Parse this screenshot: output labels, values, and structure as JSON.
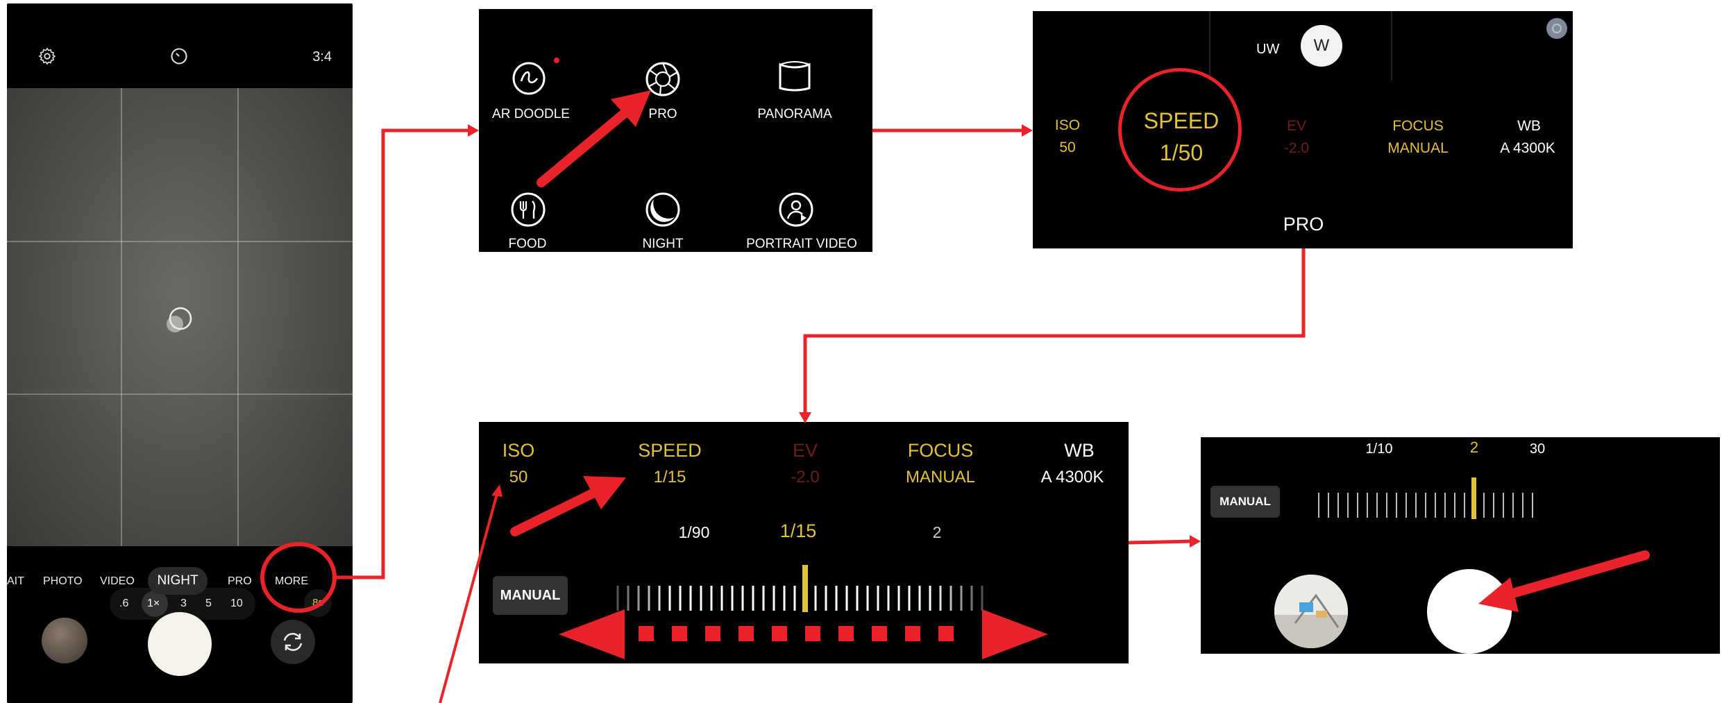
{
  "phone": {
    "aspect": "3:4",
    "icons": {
      "settings": "gear-icon",
      "timer": "timer-icon"
    },
    "zoom_levels": [
      ".6",
      "1×",
      "3",
      "5",
      "10"
    ],
    "timer_badge": "8s",
    "modes": [
      "AIT",
      "PHOTO",
      "VIDEO",
      "NIGHT",
      "PRO",
      "MORE"
    ]
  },
  "more_modes": {
    "items": [
      {
        "label": "AR DOODLE",
        "icon": "ar-doodle-icon"
      },
      {
        "label": "PRO",
        "icon": "aperture-icon"
      },
      {
        "label": "PANORAMA",
        "icon": "panorama-icon"
      },
      {
        "label": "FOOD",
        "icon": "food-icon"
      },
      {
        "label": "NIGHT",
        "icon": "moon-icon"
      },
      {
        "label": "PORTRAIT VIDEO",
        "icon": "portrait-video-icon"
      }
    ]
  },
  "pro_mode": {
    "lens": {
      "ultrawide": "UW",
      "wide": "W"
    },
    "settings": [
      {
        "label": "ISO",
        "value": "50"
      },
      {
        "label": "SPEED",
        "value": "1/50"
      },
      {
        "label": "EV",
        "value": "-2.0"
      },
      {
        "label": "FOCUS",
        "value": "MANUAL"
      },
      {
        "label": "WB",
        "value": "A 4300K"
      }
    ],
    "mode_label": "PRO"
  },
  "speed_control": {
    "settings": [
      {
        "label": "ISO",
        "value": "50"
      },
      {
        "label": "SPEED",
        "value": "1/15"
      },
      {
        "label": "EV",
        "value": "-2.0"
      },
      {
        "label": "FOCUS",
        "value": "MANUAL"
      },
      {
        "label": "WB",
        "value": "A 4300K"
      }
    ],
    "scale_labels": [
      "1/90",
      "1/15",
      "2"
    ],
    "manual_label": "MANUAL"
  },
  "final_control": {
    "scale_labels": [
      "1/10",
      "2",
      "30"
    ],
    "manual_label": "MANUAL"
  },
  "colors": {
    "accent_yellow": "#e3c23a",
    "annotation_red": "#e8232a",
    "ev_dim_red": "#6d1d1d"
  }
}
